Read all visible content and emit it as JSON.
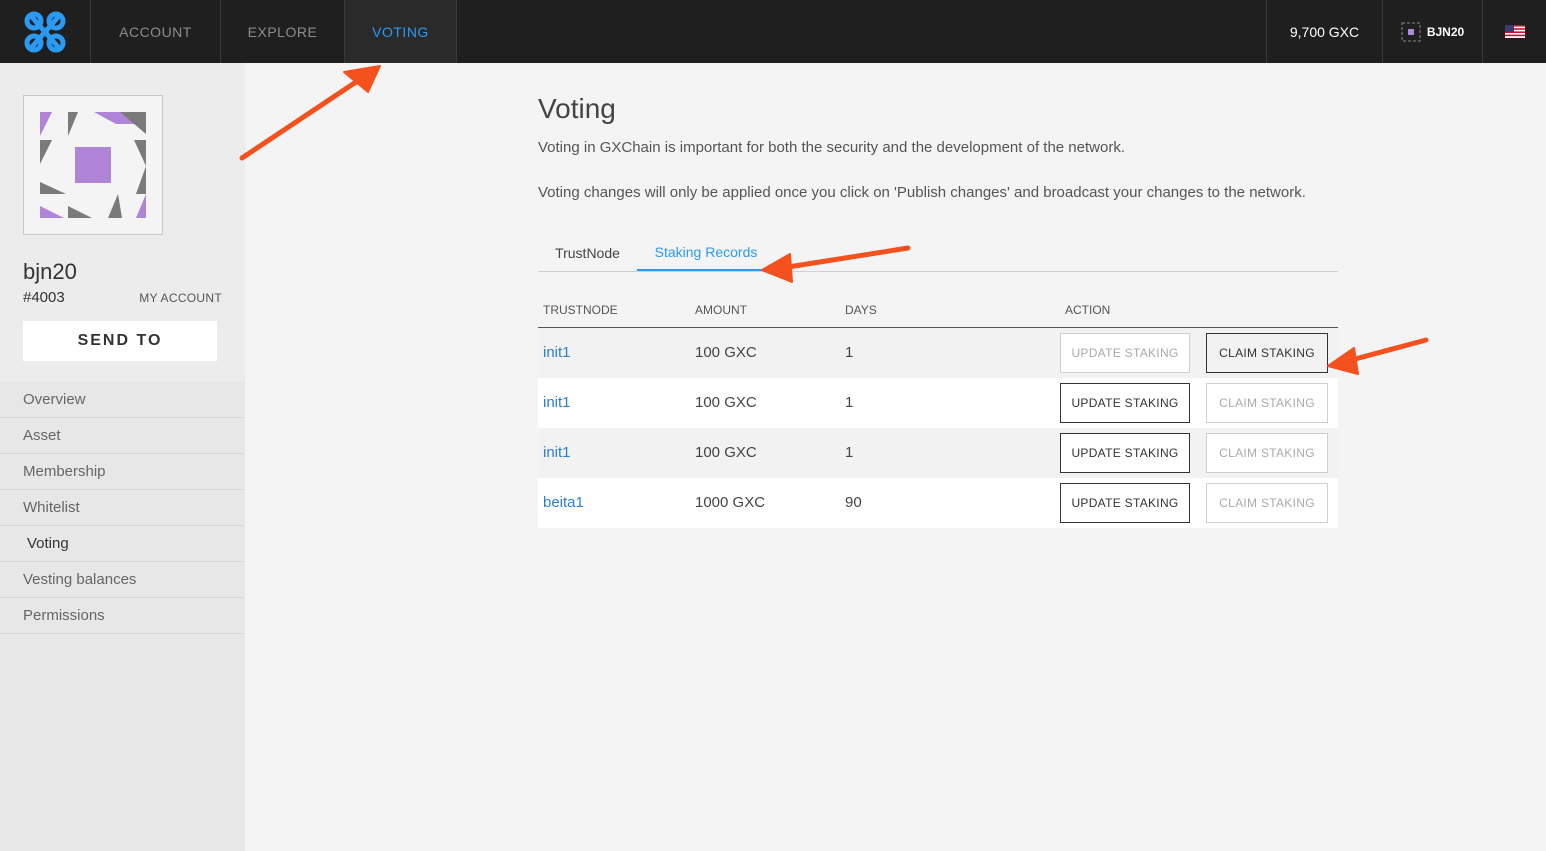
{
  "nav": {
    "tabs": [
      {
        "label": "ACCOUNT"
      },
      {
        "label": "EXPLORE"
      },
      {
        "label": "VOTING"
      }
    ],
    "balance": "9,700 GXC",
    "user": "BJN20",
    "accent_color": "#2b9af3"
  },
  "sidebar": {
    "account_name": "bjn20",
    "account_id": "#4003",
    "my_account_label": "MY ACCOUNT",
    "send_to_label": "SEND TO",
    "menu": [
      {
        "label": "Overview"
      },
      {
        "label": "Asset"
      },
      {
        "label": "Membership"
      },
      {
        "label": "Whitelist"
      },
      {
        "label": "Voting"
      },
      {
        "label": "Vesting balances"
      },
      {
        "label": "Permissions"
      }
    ]
  },
  "main": {
    "title": "Voting",
    "desc1": "Voting in GXChain is important for both the security and the development of the network.",
    "desc2": "Voting changes will only be applied once you click on 'Publish changes' and broadcast your changes to the network.",
    "tabs": [
      {
        "label": "TrustNode"
      },
      {
        "label": "Staking Records"
      }
    ],
    "table": {
      "headers": [
        "TRUSTNODE",
        "AMOUNT",
        "DAYS",
        "ACTION"
      ],
      "rows": [
        {
          "node": "init1",
          "amount": "100 GXC",
          "days": "1",
          "update": "UPDATE STAKING",
          "claim": "CLAIM STAKING"
        },
        {
          "node": "init1",
          "amount": "100 GXC",
          "days": "1",
          "update": "UPDATE STAKING",
          "claim": "CLAIM STAKING"
        },
        {
          "node": "init1",
          "amount": "100 GXC",
          "days": "1",
          "update": "UPDATE STAKING",
          "claim": "CLAIM STAKING"
        },
        {
          "node": "beita1",
          "amount": "1000 GXC",
          "days": "90",
          "update": "UPDATE STAKING",
          "claim": "CLAIM STAKING"
        }
      ]
    }
  },
  "annotation_color": "#f4511e"
}
